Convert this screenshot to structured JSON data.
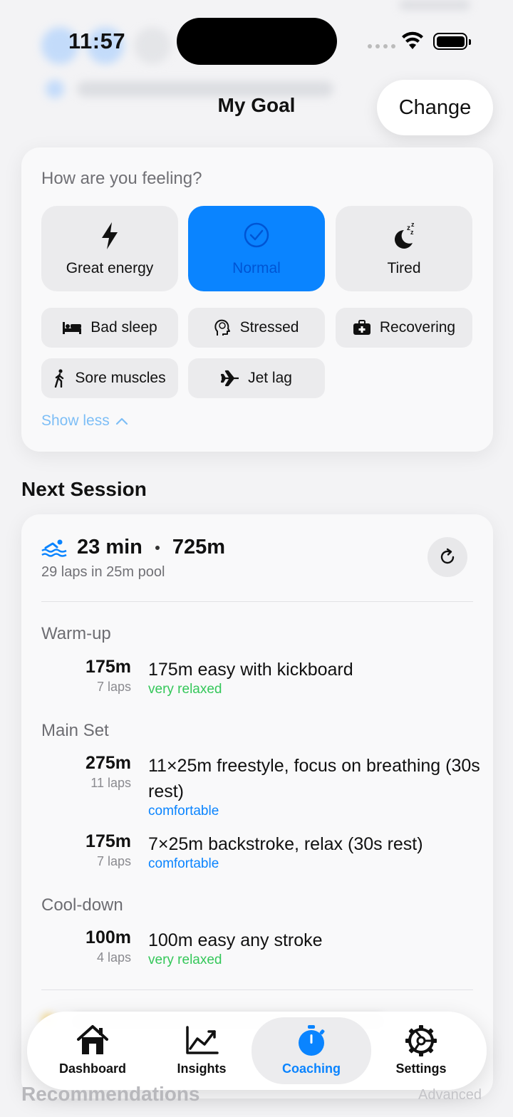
{
  "status_bar": {
    "time": "11:57"
  },
  "header": {
    "title": "My Goal",
    "change_label": "Change"
  },
  "feeling": {
    "question": "How are you feeling?",
    "moods": [
      {
        "label": "Great energy",
        "icon": "bolt-icon",
        "selected": false
      },
      {
        "label": "Normal",
        "icon": "check-circle-icon",
        "selected": true
      },
      {
        "label": "Tired",
        "icon": "moon-zzz-icon",
        "selected": false
      }
    ],
    "chips": [
      {
        "label": "Bad sleep",
        "icon": "bed-icon"
      },
      {
        "label": "Stressed",
        "icon": "head-brain-icon"
      },
      {
        "label": "Recovering",
        "icon": "medical-kit-icon"
      },
      {
        "label": "Sore muscles",
        "icon": "walking-person-icon"
      },
      {
        "label": "Jet lag",
        "icon": "airplane-icon"
      }
    ],
    "show_less": "Show less"
  },
  "next_session": {
    "section_title": "Next Session",
    "duration": "23 min",
    "distance": "725m",
    "subtitle": "29 laps in 25m pool",
    "phases": [
      {
        "name": "Warm-up",
        "steps": [
          {
            "distance": "175m",
            "laps": "7 laps",
            "description": "175m easy with kickboard",
            "effort": "very relaxed"
          }
        ]
      },
      {
        "name": "Main Set",
        "steps": [
          {
            "distance": "275m",
            "laps": "11 laps",
            "description": "11×25m freestyle, focus on breathing (30s rest)",
            "effort": "comfortable"
          },
          {
            "distance": "175m",
            "laps": "7 laps",
            "description": "7×25m backstroke, relax (30s rest)",
            "effort": "comfortable"
          }
        ]
      },
      {
        "name": "Cool-down",
        "steps": [
          {
            "distance": "100m",
            "laps": "4 laps",
            "description": "100m easy any stroke",
            "effort": "very relaxed"
          }
        ]
      }
    ]
  },
  "tabs": [
    {
      "label": "Dashboard",
      "icon": "house-icon",
      "active": false
    },
    {
      "label": "Insights",
      "icon": "chart-line-icon",
      "active": false
    },
    {
      "label": "Coaching",
      "icon": "stopwatch-icon",
      "active": true
    },
    {
      "label": "Settings",
      "icon": "gear-icon",
      "active": false
    }
  ],
  "behind": {
    "recommendations": "Recommendations",
    "advanced": "Advanced"
  },
  "colors": {
    "accent": "#0a84ff",
    "relaxed": "#34c759",
    "background": "#f3f3f5"
  }
}
